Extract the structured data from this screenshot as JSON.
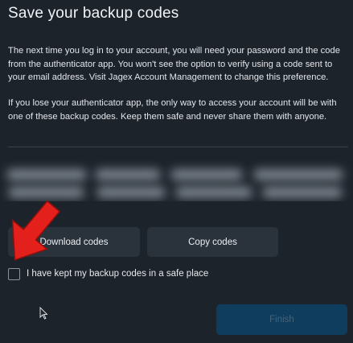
{
  "dialog": {
    "title": "Save your backup codes",
    "paragraph_1": "The next time you log in to your account, you will need your password and the code from the authenticator app. You won't see the option to verify using a code sent to your email address. Visit Jagex Account Management to change this preference.",
    "paragraph_2": "If you lose your authenticator app, the only way to access your account will be with one of these backup codes. Keep them safe and never share them with anyone."
  },
  "actions": {
    "download_label": "Download codes",
    "copy_label": "Copy codes"
  },
  "confirm": {
    "label": "I have kept my backup codes in a safe place",
    "checked": false
  },
  "footer": {
    "finish_label": "Finish",
    "finish_enabled": false
  },
  "colors": {
    "background": "#1d232b",
    "secondary_button": "#2a323c",
    "finish_button_disabled": "#0e3d5e",
    "annotation_arrow": "#e3201b"
  }
}
